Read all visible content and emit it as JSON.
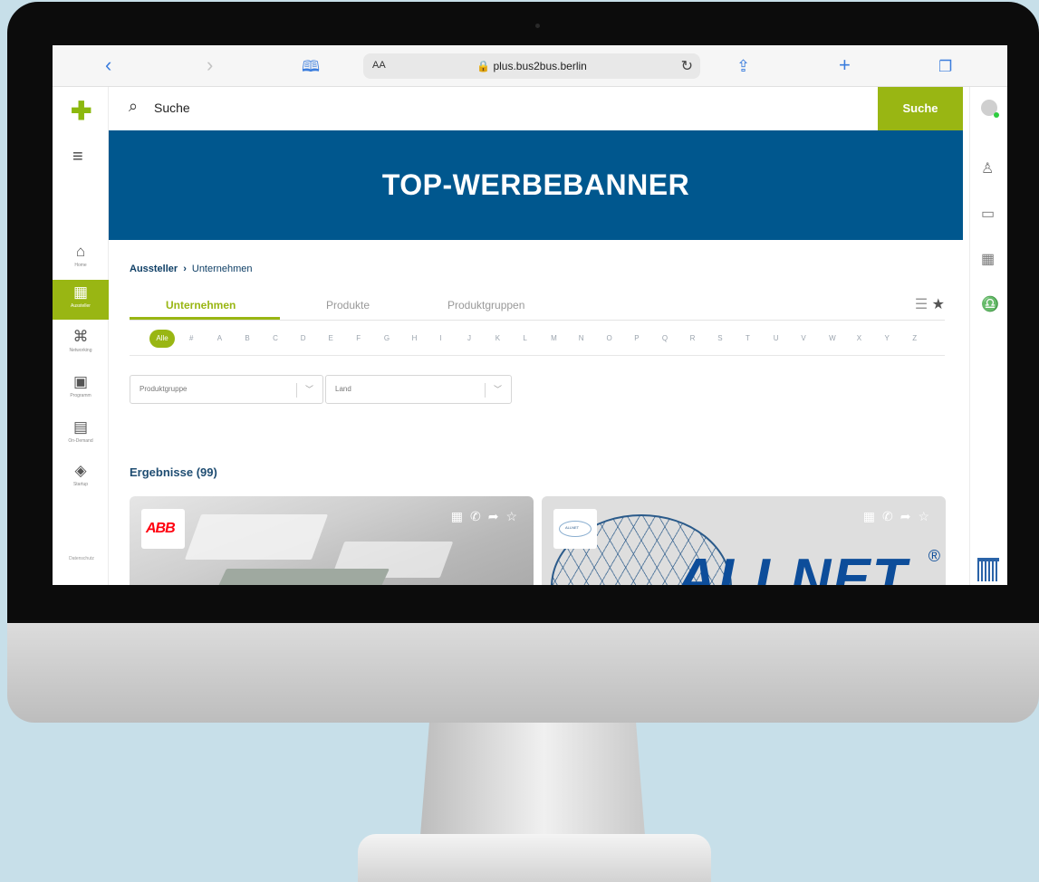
{
  "browser": {
    "url": "plus.bus2bus.berlin",
    "aa_label": "AA"
  },
  "sidebar": {
    "items": [
      {
        "label": "Home",
        "icon": "home-icon"
      },
      {
        "label": "Aussteller",
        "icon": "exhibitor-grid-icon"
      },
      {
        "label": "Networking",
        "icon": "networking-icon"
      },
      {
        "label": "Programm",
        "icon": "program-icon"
      },
      {
        "label": "On-Demand",
        "icon": "on-demand-icon"
      },
      {
        "label": "Startup",
        "icon": "startup-icon"
      }
    ],
    "footer_label": "Datenschutz"
  },
  "search": {
    "label": "Suche",
    "button": "Suche"
  },
  "banner": {
    "title": "TOP-WERBEBANNER"
  },
  "breadcrumb": {
    "root": "Aussteller",
    "current": "Unternehmen"
  },
  "tabs": [
    "Unternehmen",
    "Produkte",
    "Produktgruppen"
  ],
  "alphabet": {
    "all": "Alle",
    "letters": [
      "#",
      "A",
      "B",
      "C",
      "D",
      "E",
      "F",
      "G",
      "H",
      "I",
      "J",
      "K",
      "L",
      "M",
      "N",
      "O",
      "P",
      "Q",
      "R",
      "S",
      "T",
      "U",
      "V",
      "W",
      "X",
      "Y",
      "Z"
    ]
  },
  "filters": {
    "product_group": "Produktgruppe",
    "country": "Land"
  },
  "results": {
    "label": "Ergebnisse (99)"
  },
  "cards": [
    {
      "logo_text": "ABB"
    },
    {
      "logo_text": "ALLNET",
      "brand_text": "ALLNET",
      "reg": "®"
    }
  ],
  "colors": {
    "accent": "#99b613",
    "banner": "#00578e",
    "browser_blue": "#3b7ddd"
  }
}
